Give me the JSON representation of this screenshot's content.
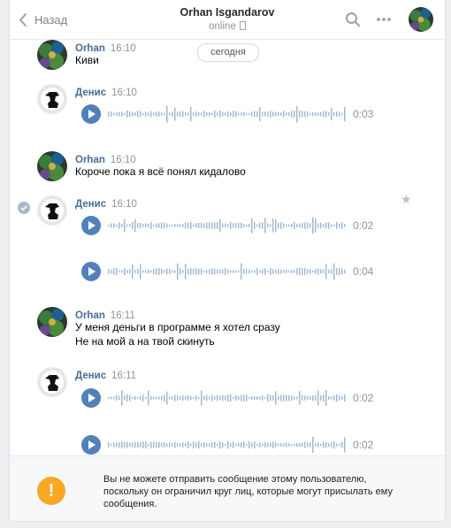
{
  "header": {
    "back_label": "Назад",
    "peer_name": "Orhan Isgandarov",
    "peer_status": "online",
    "icons": [
      "chevron-left-icon",
      "search-icon",
      "more-icon",
      "phone-icon"
    ]
  },
  "history": {
    "date_label": "сегодня",
    "messages": [
      {
        "author": "Orhan",
        "time": "16:10",
        "text": "Киви"
      },
      {
        "author": "Денис",
        "time": "16:10",
        "voice": [
          {
            "duration": "0:03"
          }
        ]
      },
      {
        "author": "Orhan",
        "time": "16:10",
        "text": "Короче пока я всё понял кидалово"
      },
      {
        "author": "Денис",
        "time": "16:10",
        "voice": [
          {
            "duration": "0:02"
          },
          {
            "duration": "0:04"
          }
        ]
      },
      {
        "author": "Orhan",
        "time": "16:11",
        "lines": [
          "У меня деньги в программе я хотел сразу",
          "Не на мой а на твой скинуть"
        ]
      },
      {
        "author": "Денис",
        "time": "16:11",
        "voice": [
          {
            "duration": "0:02"
          },
          {
            "duration": "0:02"
          }
        ]
      }
    ]
  },
  "notice": {
    "text": "Вы не можете отправить сообщение этому пользователю, поскольку он ограничил круг лиц, которые могут присылать ему сообщения."
  },
  "colors": {
    "accent": "#5181b8",
    "author": "#4a6d95",
    "warning": "#f9a825",
    "wave": "#a1b8d4"
  }
}
